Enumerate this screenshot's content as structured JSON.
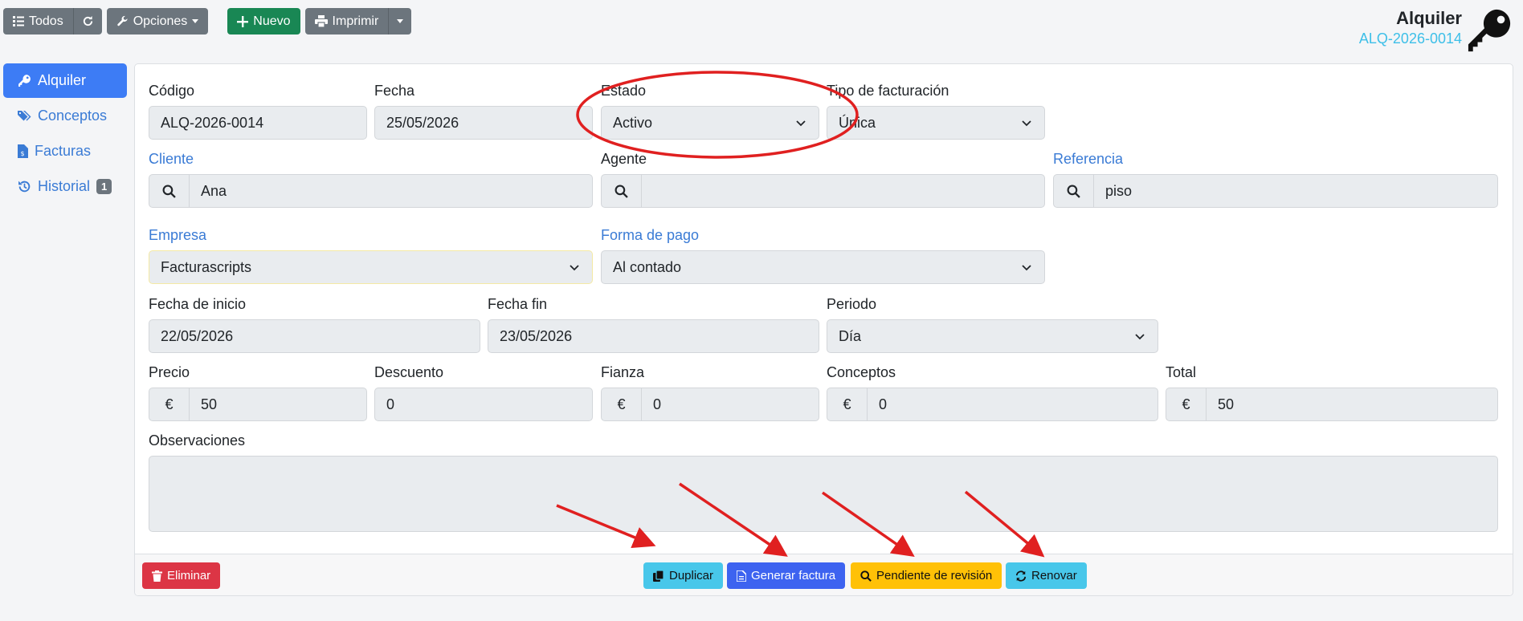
{
  "toolbar": {
    "all_label": "Todos",
    "options_label": "Opciones",
    "new_label": "Nuevo",
    "print_label": "Imprimir"
  },
  "header": {
    "title": "Alquiler",
    "code": "ALQ-2026-0014"
  },
  "sidebar": {
    "items": [
      {
        "label": "Alquiler"
      },
      {
        "label": "Conceptos"
      },
      {
        "label": "Facturas"
      },
      {
        "label": "Historial",
        "badge": "1"
      }
    ]
  },
  "form": {
    "codigo": {
      "label": "Código",
      "value": "ALQ-2026-0014"
    },
    "fecha": {
      "label": "Fecha",
      "value": "25/05/2026"
    },
    "estado": {
      "label": "Estado",
      "value": "Activo"
    },
    "tipo_facturacion": {
      "label": "Tipo de facturación",
      "value": "Única"
    },
    "cliente": {
      "label": "Cliente",
      "value": "Ana"
    },
    "agente": {
      "label": "Agente",
      "value": ""
    },
    "referencia": {
      "label": "Referencia",
      "value": "piso"
    },
    "empresa": {
      "label": "Empresa",
      "value": "Facturascripts"
    },
    "forma_pago": {
      "label": "Forma de pago",
      "value": "Al contado"
    },
    "fecha_inicio": {
      "label": "Fecha de inicio",
      "value": "22/05/2026"
    },
    "fecha_fin": {
      "label": "Fecha fin",
      "value": "23/05/2026"
    },
    "periodo": {
      "label": "Periodo",
      "value": "Día"
    },
    "precio": {
      "label": "Precio",
      "value": "50"
    },
    "descuento": {
      "label": "Descuento",
      "value": "0"
    },
    "fianza": {
      "label": "Fianza",
      "value": "0"
    },
    "conceptos": {
      "label": "Conceptos",
      "value": "0"
    },
    "total": {
      "label": "Total",
      "value": "50"
    },
    "observaciones": {
      "label": "Observaciones",
      "value": ""
    },
    "currency_symbol": "€"
  },
  "footer": {
    "delete_label": "Eliminar",
    "duplicate_label": "Duplicar",
    "invoice_label": "Generar factura",
    "review_label": "Pendiente de revisión",
    "renew_label": "Renovar"
  },
  "colors": {
    "primary": "#3d7cf5",
    "success": "#198754",
    "danger": "#dc3545",
    "info": "#48c7ea",
    "warning": "#ffc107",
    "annotation": "#e02020"
  }
}
